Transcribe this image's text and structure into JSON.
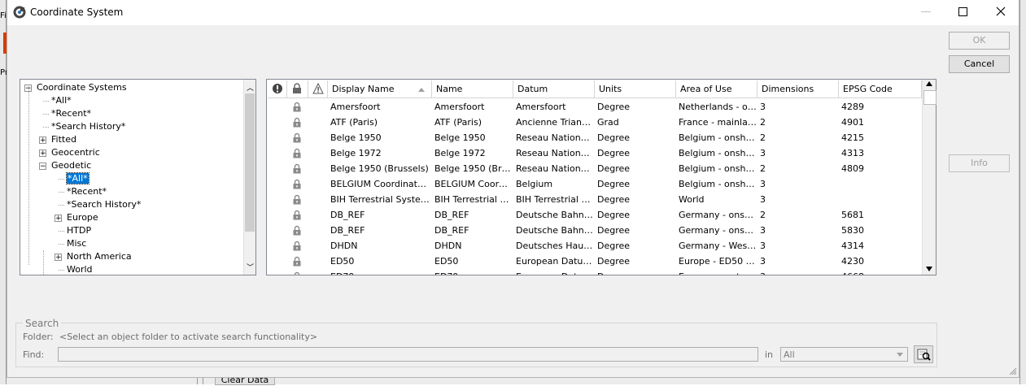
{
  "window": {
    "title": "Coordinate System"
  },
  "buttons": {
    "ok": "OK",
    "cancel": "Cancel",
    "info": "Info"
  },
  "background": {
    "clear_data": "Clear Data",
    "frag1": "Fi",
    "frag2": "Pr"
  },
  "tree": {
    "items": [
      {
        "label": "Coordinate Systems",
        "level": 0,
        "exp": "−"
      },
      {
        "label": "*All*",
        "level": 1,
        "exp": ""
      },
      {
        "label": "*Recent*",
        "level": 1,
        "exp": ""
      },
      {
        "label": "*Search History*",
        "level": 1,
        "exp": ""
      },
      {
        "label": "Fitted",
        "level": 1,
        "exp": "+"
      },
      {
        "label": "Geocentric",
        "level": 1,
        "exp": "+"
      },
      {
        "label": "Geodetic",
        "level": 1,
        "exp": "−"
      },
      {
        "label": "*All*",
        "level": 2,
        "exp": "",
        "selected": true
      },
      {
        "label": "*Recent*",
        "level": 2,
        "exp": ""
      },
      {
        "label": "*Search History*",
        "level": 2,
        "exp": ""
      },
      {
        "label": "Europe",
        "level": 2,
        "exp": "+"
      },
      {
        "label": "HTDP",
        "level": 2,
        "exp": ""
      },
      {
        "label": "Misc",
        "level": 2,
        "exp": ""
      },
      {
        "label": "North America",
        "level": 2,
        "exp": "+"
      },
      {
        "label": "World",
        "level": 2,
        "exp": ""
      }
    ]
  },
  "grid": {
    "columns": [
      "Display Name",
      "Name",
      "Datum",
      "Units",
      "Area of Use",
      "Dimensions",
      "EPSG Code"
    ],
    "rows": [
      [
        "Amersfoort",
        "Amersfoort",
        "Amersfoort",
        "Degree",
        "Netherlands - ons...",
        "3",
        "4289"
      ],
      [
        "ATF (Paris)",
        "ATF (Paris)",
        "Ancienne Triangu...",
        "Grad",
        "France - mainland...",
        "2",
        "4901"
      ],
      [
        "Belge 1950",
        "Belge 1950",
        "Reseau National ...",
        "Degree",
        "Belgium - onshore",
        "2",
        "4215"
      ],
      [
        "Belge 1972",
        "Belge 1972",
        "Reseau National ...",
        "Degree",
        "Belgium - onshore",
        "3",
        "4313"
      ],
      [
        "Belge 1950 (Brussels)",
        "Belge 1950 (Brus...",
        "Reseau National ...",
        "Degree",
        "Belgium - onshore",
        "2",
        "4809"
      ],
      [
        "BELGIUM Coordinate S...",
        "BELGIUM Coordi...",
        "Belgium",
        "Degree",
        "Belgium - onshore",
        "3",
        ""
      ],
      [
        "BIH Terrestrial System ...",
        "BIH Terrestrial Sy...",
        "BIH Terrestrial Sy...",
        "Degree",
        "World",
        "3",
        ""
      ],
      [
        "DB_REF",
        "DB_REF",
        "Deutsche Bahn ...",
        "Degree",
        "Germany - onshore",
        "2",
        "5681"
      ],
      [
        "DB_REF",
        "DB_REF",
        "Deutsche Bahn ...",
        "Degree",
        "Germany - onshore",
        "3",
        "5830"
      ],
      [
        "DHDN",
        "DHDN",
        "Deutsches Haupt...",
        "Degree",
        "Germany - West ...",
        "3",
        "4314"
      ],
      [
        "ED50",
        "ED50",
        "European Datum ...",
        "Degree",
        "Europe - ED50 by...",
        "3",
        "4230"
      ],
      [
        "ED79",
        "ED79",
        "European Datum ...",
        "Degree",
        "Europe - west",
        "3",
        "4668"
      ]
    ]
  },
  "search": {
    "group_label": "Search",
    "folder_label": "Folder:",
    "folder_value": "<Select an object folder to activate search functionality>",
    "find_label": "Find:",
    "find_value": "",
    "in_label": "in",
    "in_value": "All"
  }
}
